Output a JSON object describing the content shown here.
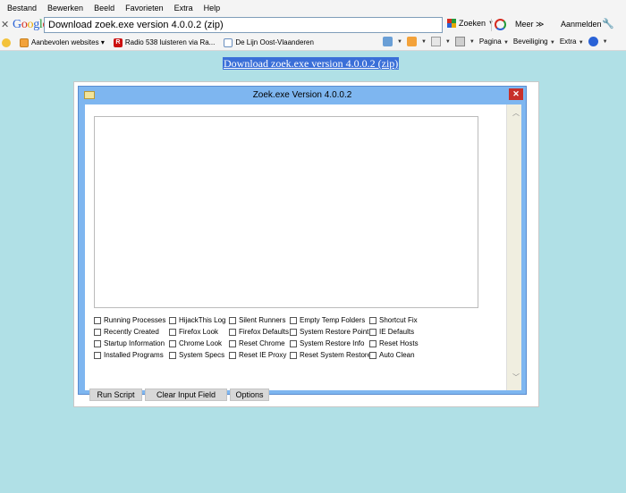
{
  "menubar": {
    "items": [
      "Bestand",
      "Bewerken",
      "Beeld",
      "Favorieten",
      "Extra",
      "Help"
    ]
  },
  "google_toolbar": {
    "search_value": "Download zoek.exe version 4.0.0.2 (zip)",
    "search_button": "Zoeken",
    "more": "Meer ≫",
    "sign_in": "Aanmelden"
  },
  "favorites": {
    "items": [
      {
        "label": "Aanbevolen websites ▾",
        "icon": "star-icon"
      },
      {
        "label": "Radio 538 luisteren via Ra...",
        "icon": "radio-r-icon"
      },
      {
        "label": "De Lijn Oost-Vlaanderen",
        "icon": "page-icon"
      }
    ],
    "commands": [
      "Pagina",
      "Beveiliging",
      "Extra"
    ]
  },
  "page": {
    "link_text": "Download zoek.exe version 4.0.0.2 (zip)"
  },
  "window": {
    "title": "Zoek.exe Version 4.0.0.2",
    "close": "✕",
    "textarea_value": "",
    "checkboxes": [
      [
        "Running Processes",
        "Recently Created",
        "Startup Information",
        "Installed Programs"
      ],
      [
        "HijackThis Log",
        "Firefox Look",
        "Chrome Look",
        "System Specs"
      ],
      [
        "Silent Runners",
        "Firefox Defaults",
        "Reset Chrome",
        "Reset IE Proxy"
      ],
      [
        "Empty Temp Folders",
        "System Restore Point",
        "System Restore Info",
        "Reset System Restore"
      ],
      [
        "Shortcut Fix",
        "IE Defaults",
        "Reset Hosts",
        "Auto Clean"
      ]
    ],
    "buttons": {
      "run": "Run Script",
      "clear": "Clear Input Field",
      "options": "Options"
    }
  },
  "colors": {
    "background": "#b0e0e6",
    "window_frame": "#7eb6f0",
    "close_red": "#c8302a",
    "link_highlight": "#3a6fd8"
  }
}
